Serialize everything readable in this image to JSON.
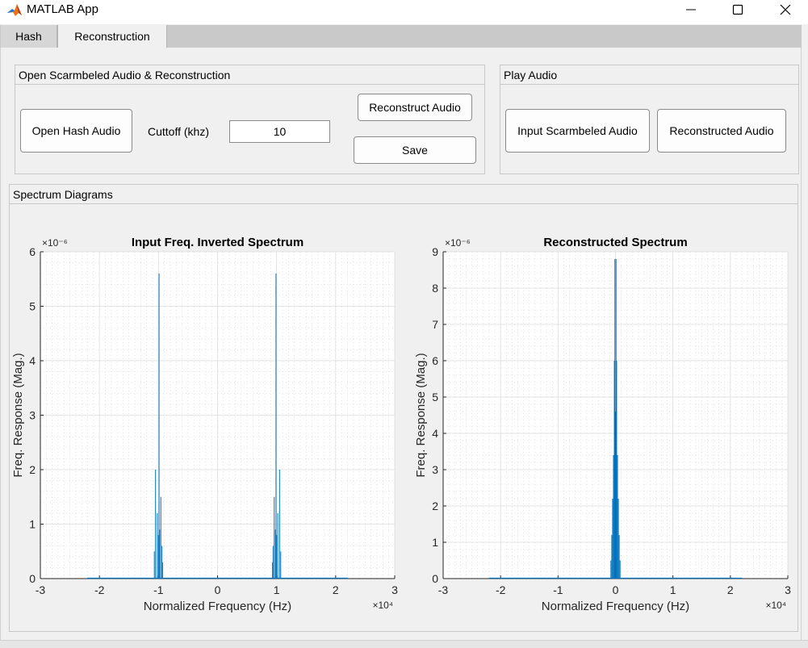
{
  "window": {
    "title": "MATLAB App"
  },
  "tabs": [
    {
      "label": "Hash"
    },
    {
      "label": "Reconstruction"
    }
  ],
  "open_panel": {
    "title": "Open Scarmbeled Audio & Reconstruction",
    "open_button": "Open Hash Audio",
    "cutoff_label": "Cuttoff (khz)",
    "cutoff_value": "10",
    "reconstruct_button": "Reconstruct Audio",
    "save_button": "Save"
  },
  "play_panel": {
    "title": "Play Audio",
    "input_button": "Input Scarmbeled Audio",
    "reconstructed_button": "Reconstructed Audio"
  },
  "spectrum_panel": {
    "title": "Spectrum Diagrams"
  },
  "colors": {
    "line": "#0072bd",
    "background": "#f0f0f0",
    "axes_bg": "#ffffff"
  },
  "chart_data": [
    {
      "type": "line",
      "title": "Input Freq. Inverted Spectrum",
      "xlabel": "Normalized Frequency (Hz)",
      "ylabel": "Freq. Response (Mag.)",
      "x_exponent_label": "×10⁴",
      "y_exponent_label": "×10⁻⁶",
      "xlim": [
        -30000,
        30000
      ],
      "ylim": [
        0,
        6
      ],
      "xticks": [
        -3,
        -2,
        -1,
        0,
        1,
        2,
        3
      ],
      "yticks": [
        0,
        1,
        2,
        3,
        4,
        5,
        6
      ],
      "grid": "major+minor",
      "x_units": "Hz",
      "y_units": "1e-6",
      "data_range_x": [
        -22050,
        22050
      ],
      "peaks": [
        {
          "x": -9900,
          "y": 5.6
        },
        {
          "x": 9900,
          "y": 5.6
        },
        {
          "x": -10500,
          "y": 2.0
        },
        {
          "x": 10500,
          "y": 2.0
        },
        {
          "x": -9600,
          "y": 1.5
        },
        {
          "x": 9600,
          "y": 1.5
        },
        {
          "x": -10200,
          "y": 1.2
        },
        {
          "x": 10200,
          "y": 1.2
        },
        {
          "x": -9800,
          "y": 0.9
        },
        {
          "x": 9800,
          "y": 0.9
        },
        {
          "x": -10000,
          "y": 0.8
        },
        {
          "x": 10000,
          "y": 0.8
        },
        {
          "x": -9400,
          "y": 0.6
        },
        {
          "x": 9400,
          "y": 0.6
        },
        {
          "x": -10700,
          "y": 0.5
        },
        {
          "x": 10700,
          "y": 0.5
        },
        {
          "x": -9300,
          "y": 0.3
        },
        {
          "x": 9300,
          "y": 0.3
        }
      ]
    },
    {
      "type": "line",
      "title": "Reconstructed Spectrum",
      "xlabel": "Normalized Frequency (Hz)",
      "ylabel": "Freq. Response (Mag.)",
      "x_exponent_label": "×10⁴",
      "y_exponent_label": "×10⁻⁶",
      "xlim": [
        -30000,
        30000
      ],
      "ylim": [
        0,
        9
      ],
      "xticks": [
        -3,
        -2,
        -1,
        0,
        1,
        2,
        3
      ],
      "yticks": [
        0,
        1,
        2,
        3,
        4,
        5,
        6,
        7,
        8,
        9
      ],
      "grid": "major+minor",
      "x_units": "Hz",
      "y_units": "1e-6",
      "data_range_x": [
        -22050,
        22050
      ],
      "peaks": [
        {
          "x": -100,
          "y": 8.8
        },
        {
          "x": 100,
          "y": 8.8
        },
        {
          "x": -200,
          "y": 6.0
        },
        {
          "x": 200,
          "y": 6.0
        },
        {
          "x": 0,
          "y": 4.6
        },
        {
          "x": -350,
          "y": 3.4
        },
        {
          "x": 350,
          "y": 3.4
        },
        {
          "x": -500,
          "y": 2.2
        },
        {
          "x": 500,
          "y": 2.2
        },
        {
          "x": -650,
          "y": 1.2
        },
        {
          "x": 650,
          "y": 1.2
        },
        {
          "x": -800,
          "y": 0.5
        },
        {
          "x": 800,
          "y": 0.5
        }
      ]
    }
  ]
}
